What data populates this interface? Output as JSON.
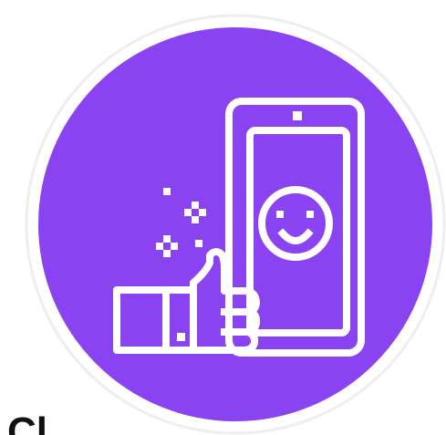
{
  "colors": {
    "background": "#ffffff",
    "ring": "#f2f2f5",
    "circle_fill": "#8a43f0",
    "icon_stroke": "#ffffff",
    "text": "#111111"
  },
  "illustration": {
    "icon_name": "smartphone-smiley-thumbs-up-icon",
    "parts": [
      "smartphone-icon",
      "smiley-face-icon",
      "thumbs-up-icon",
      "sparkle-icon"
    ]
  },
  "partial_text": "Cl"
}
